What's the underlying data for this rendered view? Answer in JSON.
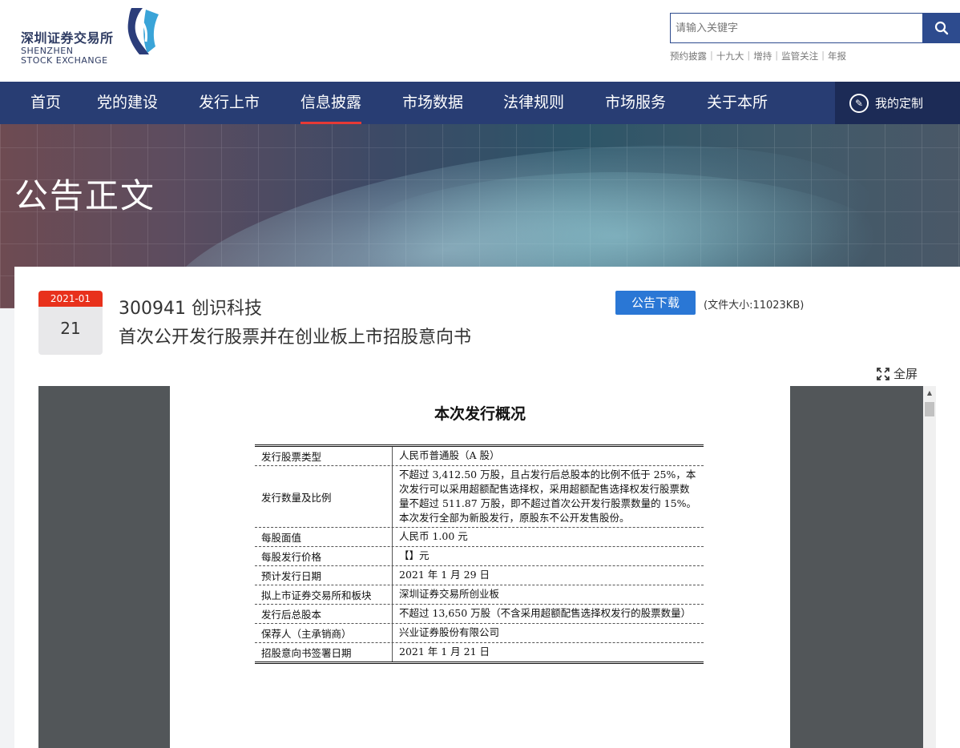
{
  "header": {
    "logo_cn": "深圳证券交易所",
    "logo_en_line1": "SHENZHEN",
    "logo_en_line2": "STOCK EXCHANGE",
    "search_placeholder": "请输入关键字",
    "quick_links": [
      "预约披露",
      "十九大",
      "增持",
      "监管关注",
      "年报"
    ]
  },
  "nav": {
    "items": [
      "首页",
      "党的建设",
      "发行上市",
      "信息披露",
      "市场数据",
      "法律规则",
      "市场服务",
      "关于本所"
    ],
    "active": "信息披露",
    "custom_label": "我的定制"
  },
  "banner": {
    "title": "公告正文"
  },
  "announcement": {
    "date_month": "2021-01",
    "date_day": "21",
    "code_name": "300941 创识科技",
    "title": "首次公开发行股票并在创业板上市招股意向书",
    "download_label": "公告下载",
    "file_size": "(文件大小:11023KB)",
    "fullscreen_label": "全屏"
  },
  "pdf": {
    "heading": "本次发行概况",
    "rows": [
      {
        "label": "发行股票类型",
        "value": "人民币普通股（A 股）"
      },
      {
        "label": "发行数量及比例",
        "value": "不超过 3,412.50 万股，且占发行后总股本的比例不低于 25%，本次发行可以采用超额配售选择权，采用超额配售选择权发行股票数量不超过 511.87 万股，即不超过首次公开发行股票数量的 15%。本次发行全部为新股发行，原股东不公开发售股份。"
      },
      {
        "label": "每股面值",
        "value": "人民币 1.00 元"
      },
      {
        "label": "每股发行价格",
        "value": "【】元"
      },
      {
        "label": "预计发行日期",
        "value": "2021 年 1 月 29 日"
      },
      {
        "label": "拟上市证券交易所和板块",
        "value": "深圳证券交易所创业板"
      },
      {
        "label": "发行后总股本",
        "value": "不超过 13,650 万股（不含采用超额配售选择权发行的股票数量）"
      },
      {
        "label": "保荐人（主承销商）",
        "value": "兴业证券股份有限公司"
      },
      {
        "label": "招股意向书签署日期",
        "value": "2021 年 1 月 21 日"
      }
    ]
  },
  "colors": {
    "nav_bg": "#283d73",
    "nav_active_underline": "#e63935",
    "date_red": "#e8311c",
    "download_blue": "#2a77d5"
  }
}
